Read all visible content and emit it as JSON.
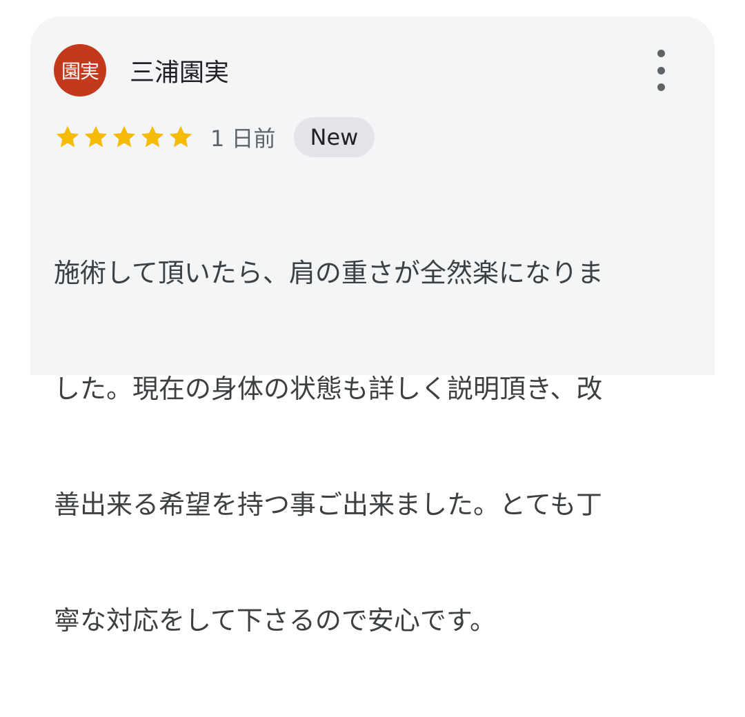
{
  "review": {
    "avatar_text": "園実",
    "avatar_color": "#c4391c",
    "reviewer_name": "三浦園実",
    "rating": 5,
    "rating_max": 5,
    "star_color": "#f6bb06",
    "time_ago": "1 日前",
    "badge": "New",
    "text_lines": [
      "施術して頂いたら、肩の重さが全然楽になりま",
      "した。現在の身体の状態も詳しく説明頂き、改",
      "善出来る希望を持つ事ご出来ました。とても丁",
      "寧な対応をして下さるので安心です。"
    ],
    "menu_icon": "more-vert-icon"
  }
}
